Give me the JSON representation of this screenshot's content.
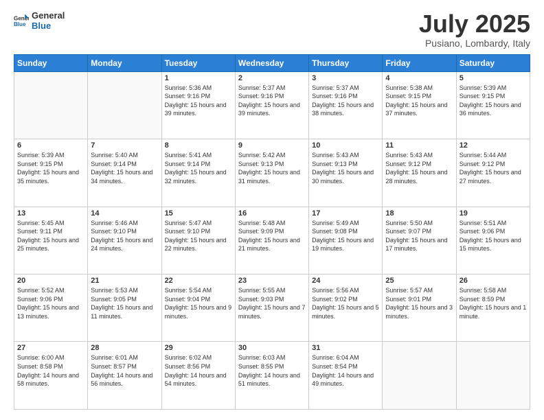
{
  "header": {
    "logo_general": "General",
    "logo_blue": "Blue",
    "month_title": "July 2025",
    "location": "Pusiano, Lombardy, Italy"
  },
  "days_of_week": [
    "Sunday",
    "Monday",
    "Tuesday",
    "Wednesday",
    "Thursday",
    "Friday",
    "Saturday"
  ],
  "weeks": [
    [
      {
        "day": "",
        "sunrise": "",
        "sunset": "",
        "daylight": ""
      },
      {
        "day": "",
        "sunrise": "",
        "sunset": "",
        "daylight": ""
      },
      {
        "day": "1",
        "sunrise": "Sunrise: 5:36 AM",
        "sunset": "Sunset: 9:16 PM",
        "daylight": "Daylight: 15 hours and 39 minutes."
      },
      {
        "day": "2",
        "sunrise": "Sunrise: 5:37 AM",
        "sunset": "Sunset: 9:16 PM",
        "daylight": "Daylight: 15 hours and 39 minutes."
      },
      {
        "day": "3",
        "sunrise": "Sunrise: 5:37 AM",
        "sunset": "Sunset: 9:16 PM",
        "daylight": "Daylight: 15 hours and 38 minutes."
      },
      {
        "day": "4",
        "sunrise": "Sunrise: 5:38 AM",
        "sunset": "Sunset: 9:15 PM",
        "daylight": "Daylight: 15 hours and 37 minutes."
      },
      {
        "day": "5",
        "sunrise": "Sunrise: 5:39 AM",
        "sunset": "Sunset: 9:15 PM",
        "daylight": "Daylight: 15 hours and 36 minutes."
      }
    ],
    [
      {
        "day": "6",
        "sunrise": "Sunrise: 5:39 AM",
        "sunset": "Sunset: 9:15 PM",
        "daylight": "Daylight: 15 hours and 35 minutes."
      },
      {
        "day": "7",
        "sunrise": "Sunrise: 5:40 AM",
        "sunset": "Sunset: 9:14 PM",
        "daylight": "Daylight: 15 hours and 34 minutes."
      },
      {
        "day": "8",
        "sunrise": "Sunrise: 5:41 AM",
        "sunset": "Sunset: 9:14 PM",
        "daylight": "Daylight: 15 hours and 32 minutes."
      },
      {
        "day": "9",
        "sunrise": "Sunrise: 5:42 AM",
        "sunset": "Sunset: 9:13 PM",
        "daylight": "Daylight: 15 hours and 31 minutes."
      },
      {
        "day": "10",
        "sunrise": "Sunrise: 5:43 AM",
        "sunset": "Sunset: 9:13 PM",
        "daylight": "Daylight: 15 hours and 30 minutes."
      },
      {
        "day": "11",
        "sunrise": "Sunrise: 5:43 AM",
        "sunset": "Sunset: 9:12 PM",
        "daylight": "Daylight: 15 hours and 28 minutes."
      },
      {
        "day": "12",
        "sunrise": "Sunrise: 5:44 AM",
        "sunset": "Sunset: 9:12 PM",
        "daylight": "Daylight: 15 hours and 27 minutes."
      }
    ],
    [
      {
        "day": "13",
        "sunrise": "Sunrise: 5:45 AM",
        "sunset": "Sunset: 9:11 PM",
        "daylight": "Daylight: 15 hours and 25 minutes."
      },
      {
        "day": "14",
        "sunrise": "Sunrise: 5:46 AM",
        "sunset": "Sunset: 9:10 PM",
        "daylight": "Daylight: 15 hours and 24 minutes."
      },
      {
        "day": "15",
        "sunrise": "Sunrise: 5:47 AM",
        "sunset": "Sunset: 9:10 PM",
        "daylight": "Daylight: 15 hours and 22 minutes."
      },
      {
        "day": "16",
        "sunrise": "Sunrise: 5:48 AM",
        "sunset": "Sunset: 9:09 PM",
        "daylight": "Daylight: 15 hours and 21 minutes."
      },
      {
        "day": "17",
        "sunrise": "Sunrise: 5:49 AM",
        "sunset": "Sunset: 9:08 PM",
        "daylight": "Daylight: 15 hours and 19 minutes."
      },
      {
        "day": "18",
        "sunrise": "Sunrise: 5:50 AM",
        "sunset": "Sunset: 9:07 PM",
        "daylight": "Daylight: 15 hours and 17 minutes."
      },
      {
        "day": "19",
        "sunrise": "Sunrise: 5:51 AM",
        "sunset": "Sunset: 9:06 PM",
        "daylight": "Daylight: 15 hours and 15 minutes."
      }
    ],
    [
      {
        "day": "20",
        "sunrise": "Sunrise: 5:52 AM",
        "sunset": "Sunset: 9:06 PM",
        "daylight": "Daylight: 15 hours and 13 minutes."
      },
      {
        "day": "21",
        "sunrise": "Sunrise: 5:53 AM",
        "sunset": "Sunset: 9:05 PM",
        "daylight": "Daylight: 15 hours and 11 minutes."
      },
      {
        "day": "22",
        "sunrise": "Sunrise: 5:54 AM",
        "sunset": "Sunset: 9:04 PM",
        "daylight": "Daylight: 15 hours and 9 minutes."
      },
      {
        "day": "23",
        "sunrise": "Sunrise: 5:55 AM",
        "sunset": "Sunset: 9:03 PM",
        "daylight": "Daylight: 15 hours and 7 minutes."
      },
      {
        "day": "24",
        "sunrise": "Sunrise: 5:56 AM",
        "sunset": "Sunset: 9:02 PM",
        "daylight": "Daylight: 15 hours and 5 minutes."
      },
      {
        "day": "25",
        "sunrise": "Sunrise: 5:57 AM",
        "sunset": "Sunset: 9:01 PM",
        "daylight": "Daylight: 15 hours and 3 minutes."
      },
      {
        "day": "26",
        "sunrise": "Sunrise: 5:58 AM",
        "sunset": "Sunset: 8:59 PM",
        "daylight": "Daylight: 15 hours and 1 minute."
      }
    ],
    [
      {
        "day": "27",
        "sunrise": "Sunrise: 6:00 AM",
        "sunset": "Sunset: 8:58 PM",
        "daylight": "Daylight: 14 hours and 58 minutes."
      },
      {
        "day": "28",
        "sunrise": "Sunrise: 6:01 AM",
        "sunset": "Sunset: 8:57 PM",
        "daylight": "Daylight: 14 hours and 56 minutes."
      },
      {
        "day": "29",
        "sunrise": "Sunrise: 6:02 AM",
        "sunset": "Sunset: 8:56 PM",
        "daylight": "Daylight: 14 hours and 54 minutes."
      },
      {
        "day": "30",
        "sunrise": "Sunrise: 6:03 AM",
        "sunset": "Sunset: 8:55 PM",
        "daylight": "Daylight: 14 hours and 51 minutes."
      },
      {
        "day": "31",
        "sunrise": "Sunrise: 6:04 AM",
        "sunset": "Sunset: 8:54 PM",
        "daylight": "Daylight: 14 hours and 49 minutes."
      },
      {
        "day": "",
        "sunrise": "",
        "sunset": "",
        "daylight": ""
      },
      {
        "day": "",
        "sunrise": "",
        "sunset": "",
        "daylight": ""
      }
    ]
  ]
}
